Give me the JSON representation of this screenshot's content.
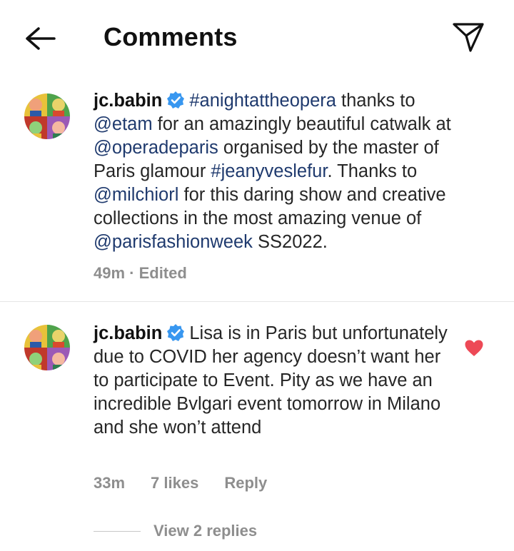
{
  "header": {
    "title": "Comments",
    "back_icon": "arrow-left-icon",
    "action_icon": "send-icon"
  },
  "comments": [
    {
      "username": "jc.babin",
      "verified": true,
      "segments": [
        {
          "t": "#anightattheopera",
          "tag": true
        },
        {
          "t": " thanks to ",
          "tag": false
        },
        {
          "t": "@etam",
          "tag": true
        },
        {
          "t": " for an amazingly beautiful catwalk at ",
          "tag": false
        },
        {
          "t": "@operadeparis",
          "tag": true
        },
        {
          "t": " organised by the master of Paris glamour ",
          "tag": false
        },
        {
          "t": "#jeanyveslefur",
          "tag": true
        },
        {
          "t": ". Thanks to ",
          "tag": false
        },
        {
          "t": "@milchiorl",
          "tag": true
        },
        {
          "t": " for this daring show and creative collections in the most amazing venue of ",
          "tag": false
        },
        {
          "t": "@parisfashionweek",
          "tag": true
        },
        {
          "t": " SS2022.",
          "tag": false
        }
      ],
      "meta": "49m · Edited"
    },
    {
      "username": "jc.babin",
      "verified": true,
      "text": "Lisa is in Paris but unfortunately due to COVID her agency doesn’t want her to participate to Event. Pity as we have an incredible Bvlgari event tomorrow in Milano and she won’t attend",
      "time": "33m",
      "likes": "7 likes",
      "reply_label": "Reply",
      "liked": true
    }
  ],
  "view_replies": "View 2 replies",
  "colors": {
    "text": "#262626",
    "muted": "#8e8e8e",
    "tag": "#1f3a6e",
    "verified": "#3897f0",
    "heart": "#ed4956"
  }
}
